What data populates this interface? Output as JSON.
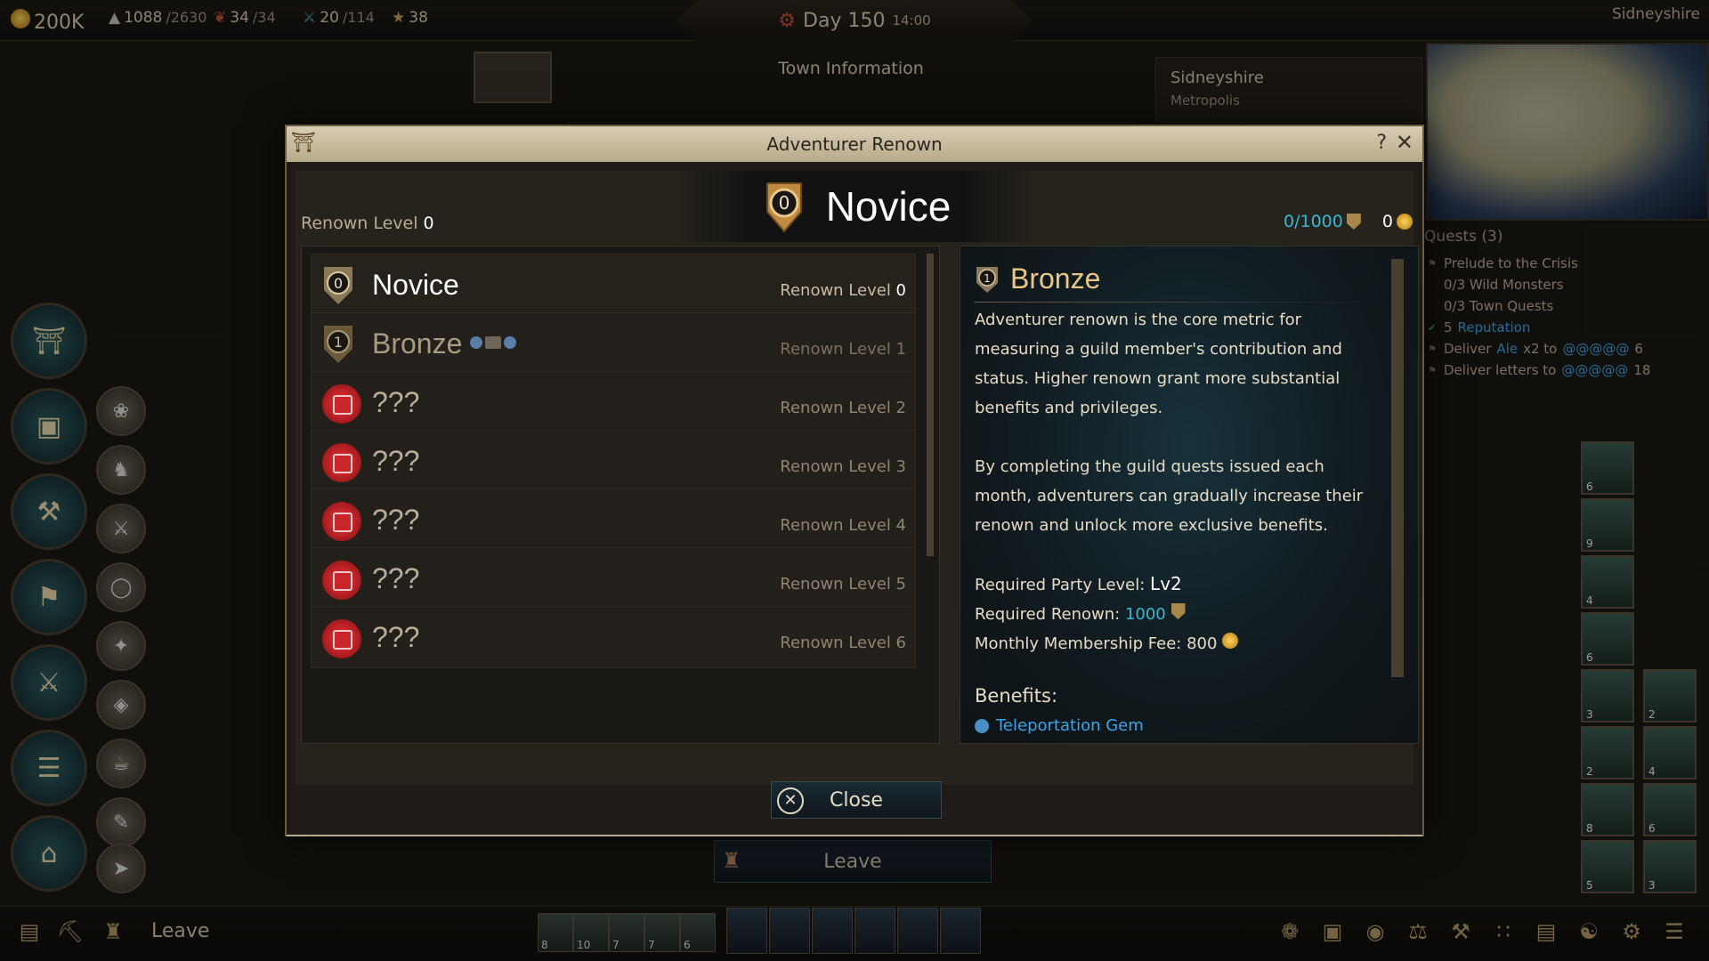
{
  "topbar": {
    "gold": "200K",
    "population": "1088",
    "population_max": "/2630",
    "food": "34",
    "food_max": "/34",
    "troops": "20",
    "troops_max": "/114",
    "reputation": "38",
    "day_label": "Day 150",
    "time": "14:00",
    "town_name": "Sidneyshire"
  },
  "background": {
    "town_info_title": "Town Information",
    "town_name": "Sidneyshire",
    "town_type": "Metropolis",
    "leave_button": "Leave"
  },
  "quests": {
    "header": "Quests (3)",
    "items": [
      {
        "text": "Prelude to the Crisis"
      },
      {
        "text": "0/3 Wild Monsters"
      },
      {
        "text": "0/3 Town Quests"
      },
      {
        "prefix": "5",
        "text": "Reputation"
      },
      {
        "prefix": "Deliver ",
        "item": "Ale",
        "mid": " x2 to ",
        "target": "@@@@@",
        "suffix": "6"
      },
      {
        "prefix": "Deliver letters to ",
        "target": "@@@@@",
        "suffix": "18"
      }
    ]
  },
  "modal": {
    "title": "Adventurer Renown",
    "help": "?",
    "close_x": "✕",
    "current_rank": "Novice",
    "current_rank_number": "0",
    "renown_level_label": "Renown Level ",
    "renown_level_value": "0",
    "renown_progress": "0/1000",
    "gold_value": "0",
    "ranks": [
      {
        "name": "Novice",
        "medal": "0",
        "level_label": "Renown Level ",
        "level": "0"
      },
      {
        "name": "Bronze",
        "medal": "1",
        "level_label": "Renown Level ",
        "level": "1"
      },
      {
        "name": "???",
        "level_label": "Renown Level ",
        "level": "2"
      },
      {
        "name": "???",
        "level_label": "Renown Level ",
        "level": "3"
      },
      {
        "name": "???",
        "level_label": "Renown Level ",
        "level": "4"
      },
      {
        "name": "???",
        "level_label": "Renown Level ",
        "level": "5"
      },
      {
        "name": "???",
        "level_label": "Renown Level ",
        "level": "6"
      }
    ],
    "detail": {
      "name": "Bronze",
      "medal": "1",
      "para1": "Adventurer renown is the core metric for measuring a guild member's contribution and status. Higher renown grant more substantial benefits and privileges.",
      "para2": "By completing the guild quests issued each month, adventurers can gradually increase their renown and unlock more exclusive benefits.",
      "req_party_label": "Required Party Level: ",
      "req_party_value": "Lv2",
      "req_renown_label": "Required Renown: ",
      "req_renown_value": "1000",
      "fee_label": "Monthly Membership Fee: ",
      "fee_value": "800",
      "benefits_label": "Benefits:",
      "benefit_1": "Teleportation Gem"
    },
    "close_button": "Close"
  },
  "bottombar": {
    "leave_label": "Leave",
    "party_levels": [
      "8",
      "10",
      "7",
      "7",
      "6"
    ]
  },
  "portraits": [
    "6",
    "9",
    "4",
    "6",
    "3",
    "2",
    "2",
    "4",
    "8",
    "6",
    "5",
    "3"
  ],
  "colors": {
    "accent_cyan": "#38b6d6",
    "gold": "#e6c98a",
    "title_bar": "#d8cdb2"
  }
}
